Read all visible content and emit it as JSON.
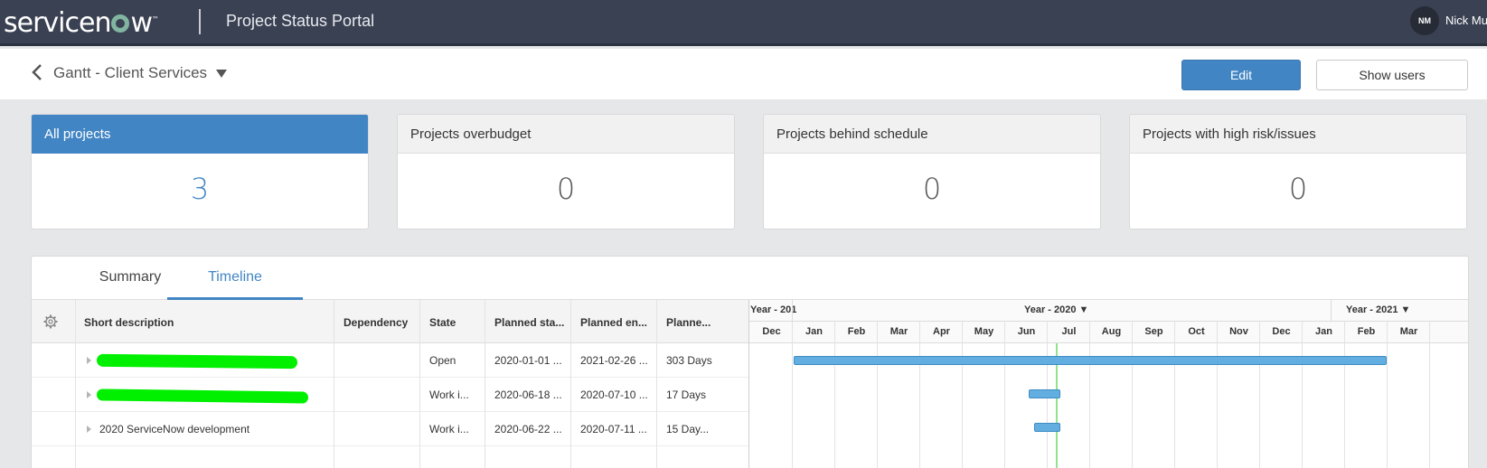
{
  "brand": {
    "logo_text_pre": "servicen",
    "logo_text_post": "w",
    "logo_tm": "™",
    "portal_title": "Project Status Portal"
  },
  "user": {
    "initials": "NM",
    "name": "Nick Mu"
  },
  "header": {
    "title": "Gantt - Client Services",
    "edit_label": "Edit",
    "show_users_label": "Show users"
  },
  "cards": [
    {
      "label": "All projects",
      "value": "3"
    },
    {
      "label": "Projects overbudget",
      "value": "0"
    },
    {
      "label": "Projects behind schedule",
      "value": "0"
    },
    {
      "label": "Projects with high risk/issues",
      "value": "0"
    }
  ],
  "tabs": [
    {
      "label": "Summary"
    },
    {
      "label": "Timeline"
    }
  ],
  "grid": {
    "columns": [
      "Short description",
      "Dependency",
      "State",
      "Planned sta...",
      "Planned en...",
      "Planne..."
    ],
    "rows": [
      {
        "description": "",
        "dependency": "",
        "state": "Open",
        "planned_start": "2020-01-01 ...",
        "planned_end": "2021-02-26 ...",
        "duration": "303 Days"
      },
      {
        "description": "",
        "dependency": "",
        "state": "Work i...",
        "planned_start": "2020-06-18 ...",
        "planned_end": "2020-07-10 ...",
        "duration": "17 Days"
      },
      {
        "description": "2020 ServiceNow development",
        "dependency": "",
        "state": "Work i...",
        "planned_start": "2020-06-22 ...",
        "planned_end": "2020-07-11 ...",
        "duration": "15 Day..."
      }
    ]
  },
  "timeline": {
    "years": [
      "Year - 201",
      "Year - 2020 ▼",
      "Year - 2021 ▼"
    ],
    "months": [
      "Dec",
      "Jan",
      "Feb",
      "Mar",
      "Apr",
      "May",
      "Jun",
      "Jul",
      "Aug",
      "Sep",
      "Oct",
      "Nov",
      "Dec",
      "Jan",
      "Feb",
      "Mar"
    ]
  },
  "colors": {
    "accent": "#4285c4",
    "nav_bg": "#3a4152",
    "bar": "#62aee0",
    "today_line": "#8fe58f",
    "redaction": "#00f000"
  }
}
